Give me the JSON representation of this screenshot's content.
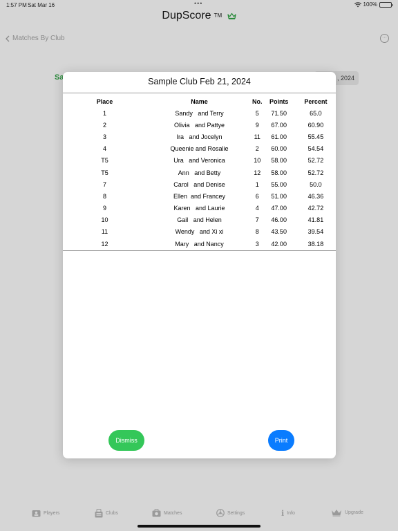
{
  "status": {
    "time": "1:57 PM",
    "date": "Sat Mar 16",
    "battery": "100%"
  },
  "header": {
    "title": "DupScore",
    "tm": "TM",
    "back_label": "Matches By Club"
  },
  "background": {
    "left_text": "Sa",
    "date_text": ", 2024"
  },
  "modal": {
    "title": "Sample Club  Feb 21, 2024",
    "columns": [
      "Place",
      "Name",
      "No.",
      "Points",
      "Percent"
    ],
    "rows": [
      [
        "1",
        "Sandy   and Terry",
        "5",
        "71.50",
        "65.0"
      ],
      [
        "2",
        "Olivia   and Pattye",
        "9",
        "67.00",
        "60.90"
      ],
      [
        "3",
        "Ira   and Jocelyn",
        "11",
        "61.00",
        "55.45"
      ],
      [
        "4",
        "Queenie and Rosalie",
        "2",
        "60.00",
        "54.54"
      ],
      [
        "T5",
        "Ura   and Veronica",
        "10",
        "58.00",
        "52.72"
      ],
      [
        "T5",
        "Ann   and Betty",
        "12",
        "58.00",
        "52.72"
      ],
      [
        "7",
        "Carol   and Denise",
        "1",
        "55.00",
        "50.0"
      ],
      [
        "8",
        "Ellen  and Francey",
        "6",
        "51.00",
        "46.36"
      ],
      [
        "9",
        "Karen   and Laurie",
        "4",
        "47.00",
        "42.72"
      ],
      [
        "10",
        "Gail   and Helen",
        "7",
        "46.00",
        "41.81"
      ],
      [
        "11",
        "Wendy   and Xi xi",
        "8",
        "43.50",
        "39.54"
      ],
      [
        "12",
        "Mary   and Nancy",
        "3",
        "42.00",
        "38.18"
      ]
    ],
    "dismiss_label": "Dismiss",
    "print_label": "Print"
  },
  "colors": {
    "green": "#34c759",
    "blue": "#0a7cff"
  },
  "tabbar": {
    "players": "Players",
    "clubs": "Clubs",
    "matches": "Matches",
    "settings": "Settings",
    "info": "Info",
    "upgrade": "Upgrade"
  }
}
